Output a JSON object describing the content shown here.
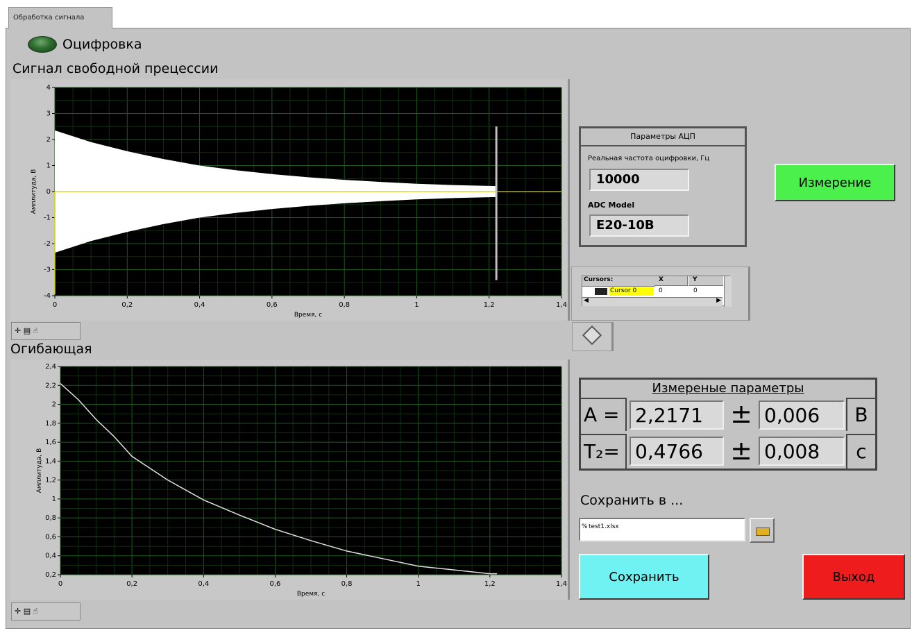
{
  "tab": {
    "label": "Обработка сигнала"
  },
  "led": {
    "label": "Оцифровка"
  },
  "graph1": {
    "title": "Сигнал свободной прецессии",
    "ylabel": "Амплитуда, В",
    "xlabel": "Время, с",
    "xticks": [
      "0",
      "0,2",
      "0,4",
      "0,6",
      "0,8",
      "1",
      "1,2",
      "1,4"
    ],
    "yticks": [
      "4",
      "3",
      "2",
      "1",
      "0",
      "-1",
      "-2",
      "-3",
      "-4"
    ],
    "palette": "✛ ▤ ☝"
  },
  "graph2": {
    "title": "Огибающая",
    "ylabel": "Амплитуда, В",
    "xlabel": "Время, с",
    "xticks": [
      "0",
      "0,2",
      "0,4",
      "0,6",
      "0,8",
      "1",
      "1,2",
      "1,4"
    ],
    "yticks": [
      "2,4",
      "2,2",
      "2",
      "1,8",
      "1,6",
      "1,4",
      "1,2",
      "1",
      "0,8",
      "0,6",
      "0,4",
      "0,2"
    ],
    "palette": "✛ ▤ ☝"
  },
  "chart_data": [
    {
      "type": "area",
      "title": "Сигнал свободной прецессии",
      "xlabel": "Время, с",
      "ylabel": "Амплитуда, В",
      "xlim": [
        0,
        1.4
      ],
      "ylim": [
        -4,
        4
      ],
      "grid": true,
      "series": [
        {
          "x": [
            0,
            0.1,
            0.2,
            0.3,
            0.4,
            0.5,
            0.6,
            0.7,
            0.8,
            0.9,
            1.0,
            1.1,
            1.22
          ],
          "values": [
            2.35,
            1.9,
            1.55,
            1.25,
            1.0,
            0.82,
            0.67,
            0.55,
            0.45,
            0.37,
            0.3,
            0.25,
            0.21
          ]
        }
      ],
      "cursor_x": 1.22
    },
    {
      "type": "line",
      "title": "Огибающая",
      "xlabel": "Время, с",
      "ylabel": "Амплитуда, В",
      "xlim": [
        0,
        1.4
      ],
      "ylim": [
        0.2,
        2.4
      ],
      "grid": true,
      "series": [
        {
          "x": [
            0,
            0.05,
            0.1,
            0.15,
            0.2,
            0.3,
            0.4,
            0.5,
            0.6,
            0.7,
            0.8,
            0.9,
            1.0,
            1.1,
            1.2,
            1.22
          ],
          "values": [
            2.22,
            2.05,
            1.84,
            1.66,
            1.45,
            1.2,
            0.99,
            0.83,
            0.68,
            0.56,
            0.45,
            0.37,
            0.29,
            0.25,
            0.21,
            0.21
          ]
        }
      ]
    }
  ],
  "adc": {
    "title": "Параметры АЦП",
    "freq_label": "Реальная частота оцифровки, Гц",
    "freq_value": "10000",
    "model_label": "ADC Model",
    "model_value": "E20-10B"
  },
  "cursors": {
    "header": "Cursors:",
    "col_x": "X",
    "col_y": "Y",
    "name": "Cursor 0",
    "x": "0",
    "y": "0"
  },
  "measure_button": {
    "label": "Измерение",
    "color": "#4cf04c"
  },
  "results": {
    "title": "Измереные параметры",
    "rows": [
      {
        "name": "A =",
        "value": "2,2171",
        "pm": "±",
        "err": "0,006",
        "unit": "В"
      },
      {
        "name": "T₂=",
        "value": "0,4766",
        "pm": "±",
        "err": "0,008",
        "unit": "с"
      }
    ]
  },
  "save": {
    "label": "Сохранить в ...",
    "path": "test1.xlsx",
    "path_prefix": "%",
    "button": "Сохранить",
    "button_color": "#70f2f2"
  },
  "exit_button": {
    "label": "Выход",
    "color": "#ee1c1c"
  }
}
